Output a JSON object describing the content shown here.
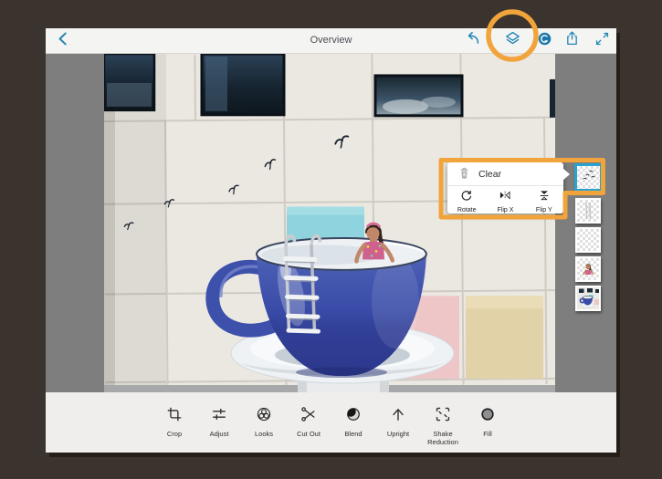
{
  "topbar": {
    "title": "Overview",
    "back_icon": "chevron-left-icon",
    "actions": [
      {
        "name": "undo",
        "icon": "undo-icon"
      },
      {
        "name": "layers",
        "icon": "layers-icon"
      },
      {
        "name": "creative-cloud-sync",
        "icon": "creative-cloud-icon"
      },
      {
        "name": "share",
        "icon": "share-icon"
      },
      {
        "name": "fullscreen",
        "icon": "expand-icon"
      }
    ]
  },
  "layer_menu": {
    "clear_label": "Clear",
    "clear_icon": "trash-icon",
    "actions": [
      {
        "label": "Rotate",
        "icon": "rotate-icon"
      },
      {
        "label": "Flip X",
        "icon": "flip-x-icon"
      },
      {
        "label": "Flip Y",
        "icon": "flip-y-icon"
      }
    ]
  },
  "toolbar": {
    "items": [
      {
        "label": "Crop",
        "icon": "crop-icon"
      },
      {
        "label": "Adjust",
        "icon": "adjust-icon"
      },
      {
        "label": "Looks",
        "icon": "looks-icon"
      },
      {
        "label": "Cut Out",
        "icon": "cut-out-icon"
      },
      {
        "label": "Blend",
        "icon": "blend-icon"
      },
      {
        "label": "Upright",
        "icon": "upright-icon"
      },
      {
        "label": "Shake Reduction",
        "icon": "shake-reduction-icon"
      },
      {
        "label": "Fill",
        "icon": "fill-icon"
      }
    ]
  },
  "layers_panel": {
    "thumbnails": [
      {
        "name": "birds-layer",
        "selected": true
      },
      {
        "name": "ladder-layer",
        "selected": false
      },
      {
        "name": "blank-layer",
        "selected": false
      },
      {
        "name": "woman-layer",
        "selected": false
      },
      {
        "name": "background-photo-layer",
        "selected": false
      }
    ]
  },
  "annotations": {
    "ring_target": "layers-button",
    "box_target": "layer-context-menu-and-selected-layer",
    "color": "#f2a43c"
  },
  "colors": {
    "frame": "#3b332e",
    "canvas_background": "#7e7e7e",
    "bar_background": "#f4f4f2",
    "accent_blue": "#2084b4",
    "selection_blue": "#2aa3cf",
    "annotation_orange": "#f2a43c",
    "cup_blue": "#3a4ca8"
  }
}
